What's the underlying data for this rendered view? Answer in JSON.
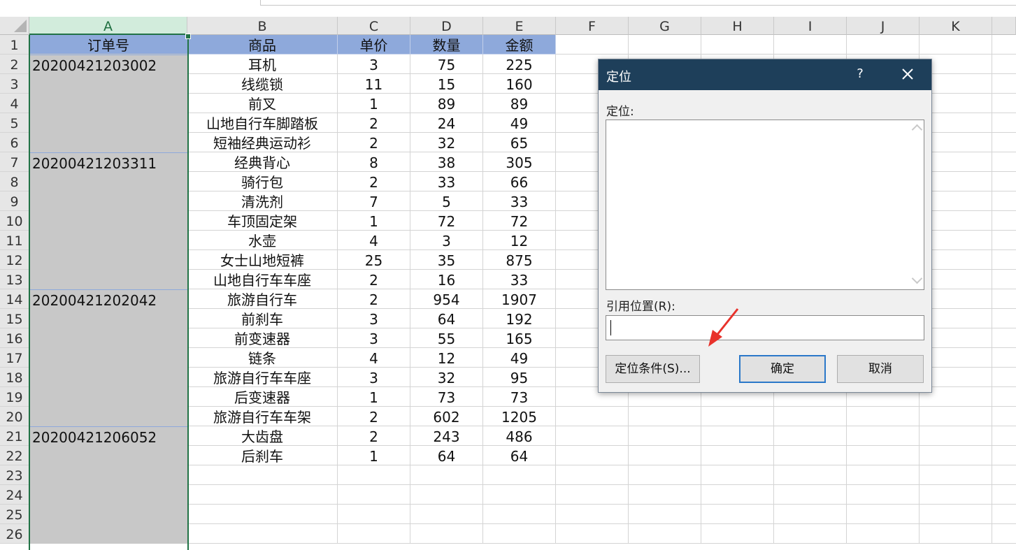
{
  "sheet": {
    "columns": [
      "A",
      "B",
      "C",
      "D",
      "E",
      "F",
      "G",
      "H",
      "I",
      "J",
      "K"
    ],
    "row_numbers": [
      "1",
      "2",
      "3",
      "4",
      "5",
      "6",
      "7",
      "8",
      "9",
      "10",
      "11",
      "12",
      "13",
      "14",
      "15",
      "16",
      "17",
      "18",
      "19",
      "20",
      "21",
      "22",
      "23",
      "24",
      "25",
      "26"
    ],
    "selected_column": "A",
    "header_fill": "#8ea9db",
    "selection_fill": "#c8c8c8",
    "selection_border": "#217346",
    "rows": [
      [
        "订单号",
        "商品",
        "单价",
        "数量",
        "金额"
      ],
      [
        "20200421203002",
        "耳机",
        "3",
        "75",
        "225"
      ],
      [
        "",
        "线缆锁",
        "11",
        "15",
        "160"
      ],
      [
        "",
        "前叉",
        "1",
        "89",
        "89"
      ],
      [
        "",
        "山地自行车脚踏板",
        "2",
        "24",
        "49"
      ],
      [
        "",
        "短袖经典运动衫",
        "2",
        "32",
        "65"
      ],
      [
        "20200421203311",
        "经典背心",
        "8",
        "38",
        "305"
      ],
      [
        "",
        "骑行包",
        "2",
        "33",
        "66"
      ],
      [
        "",
        "清洗剂",
        "7",
        "5",
        "33"
      ],
      [
        "",
        "车顶固定架",
        "1",
        "72",
        "72"
      ],
      [
        "",
        "水壶",
        "4",
        "3",
        "12"
      ],
      [
        "",
        "女士山地短裤",
        "25",
        "35",
        "875"
      ],
      [
        "",
        "山地自行车车座",
        "2",
        "16",
        "33"
      ],
      [
        "20200421202042",
        "旅游自行车",
        "2",
        "954",
        "1907"
      ],
      [
        "",
        "前刹车",
        "3",
        "64",
        "192"
      ],
      [
        "",
        "前变速器",
        "3",
        "55",
        "165"
      ],
      [
        "",
        "链条",
        "4",
        "12",
        "49"
      ],
      [
        "",
        "旅游自行车车座",
        "3",
        "32",
        "95"
      ],
      [
        "",
        "后变速器",
        "1",
        "73",
        "73"
      ],
      [
        "",
        "旅游自行车车架",
        "2",
        "602",
        "1205"
      ],
      [
        "20200421206052",
        "大齿盘",
        "2",
        "243",
        "486"
      ],
      [
        "",
        "后刹车",
        "1",
        "64",
        "64"
      ]
    ]
  },
  "dialog": {
    "title": "定位",
    "help": "?",
    "close_icon": "close-icon",
    "goto_label": "定位:",
    "reference_label": "引用位置(R):",
    "reference_value": "",
    "special_button": "定位条件(S)...",
    "ok_button": "确定",
    "cancel_button": "取消",
    "title_bar_color": "#1e3f5a"
  },
  "annotation": {
    "arrow_color": "#e8322b",
    "arrow_icon": "red-arrow-icon"
  }
}
